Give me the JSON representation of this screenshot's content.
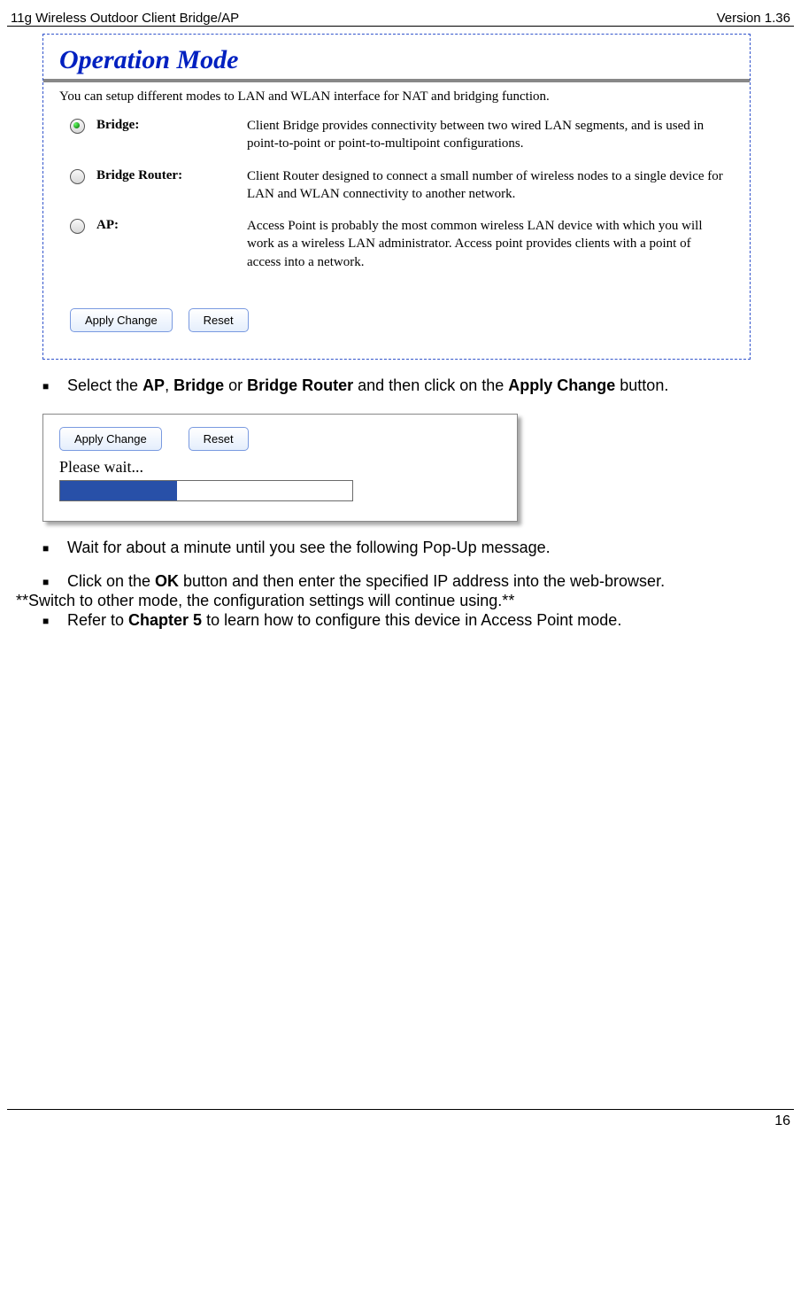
{
  "header": {
    "left": "11g Wireless Outdoor Client Bridge/AP",
    "right": "Version 1.36"
  },
  "op": {
    "title": "Operation Mode",
    "desc": "You can setup different modes to LAN and WLAN interface for NAT and bridging function.",
    "modes": {
      "bridge": {
        "label": "Bridge:",
        "desc": "Client Bridge provides connectivity between two wired LAN segments, and is used in point-to-point or point-to-multipoint configurations."
      },
      "brouter": {
        "label": "Bridge Router:",
        "desc": "Client Router designed to connect a small number of wireless nodes to a single device for LAN and WLAN connectivity to another network."
      },
      "ap": {
        "label": "AP:",
        "desc": "Access Point is probably the most common wireless LAN device with which you will work as a wireless LAN administrator. Access point provides clients with a point of access into a network."
      }
    },
    "buttons": {
      "apply": "Apply Change",
      "reset": "Reset"
    }
  },
  "instr": {
    "select_pre": "Select the ",
    "ap": "AP",
    "comma": ", ",
    "bridge": "Bridge",
    "or": " or ",
    "brouter": "Bridge Router",
    "select_mid": " and then click on the ",
    "applyc": "Apply Change",
    "select_post": " button.",
    "wait": "Wait for about a minute until you see the following Pop-Up message.",
    "ok_pre": "Click on the ",
    "ok": "OK",
    "ok_post": " button and then enter the specified IP address into the web-browser.",
    "switch_note": "**Switch to other mode, the configuration settings will continue using.**",
    "refer_pre": "Refer to ",
    "ch5": "Chapter 5",
    "refer_post": " to learn how to configure this device in Access Point mode."
  },
  "popup": {
    "apply": "Apply Change",
    "reset": "Reset",
    "wait": "Please wait..."
  },
  "footer": {
    "page": "16"
  }
}
